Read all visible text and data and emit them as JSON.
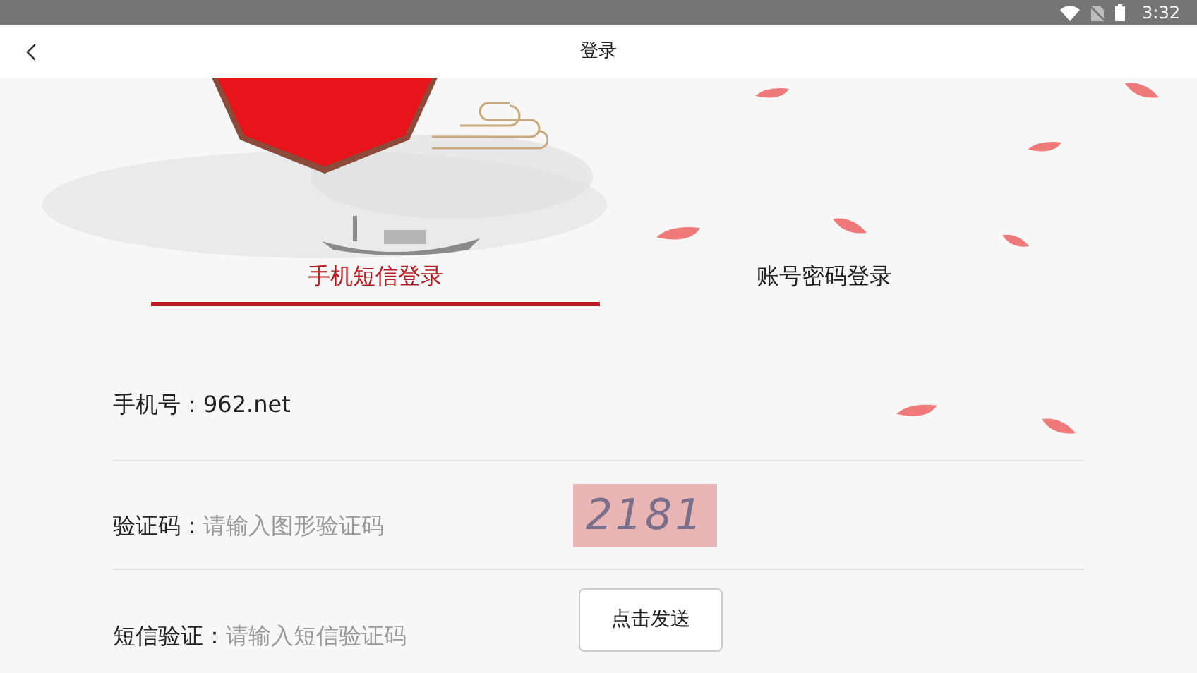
{
  "status_bar": {
    "time": "3:32"
  },
  "header": {
    "title": "登录"
  },
  "tabs": [
    {
      "label": "手机短信登录",
      "selected": true
    },
    {
      "label": "账号密码登录",
      "selected": false
    }
  ],
  "form": {
    "phone": {
      "label": "手机号：",
      "value": "962.net"
    },
    "captcha": {
      "label": "验证码：",
      "placeholder": "请输入图形验证码",
      "image_text": "2181"
    },
    "sms": {
      "label": "短信验证：",
      "placeholder": "请输入短信验证码",
      "button": "点击发送"
    }
  }
}
